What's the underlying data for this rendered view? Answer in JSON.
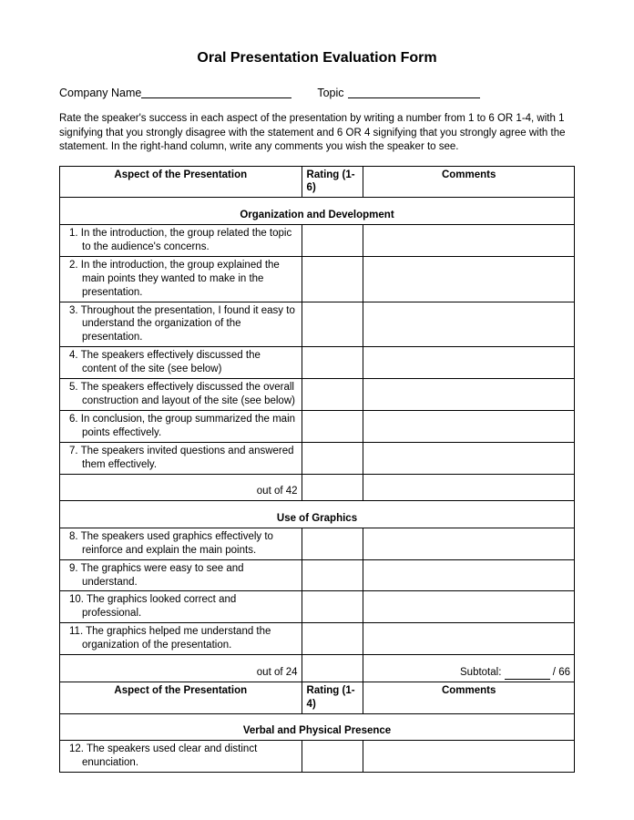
{
  "title": "Oral Presentation Evaluation Form",
  "meta": {
    "company_label": "Company Name",
    "topic_label": "Topic"
  },
  "instructions": "Rate the speaker's success in each aspect of the presentation by writing a number from 1 to 6 OR 1-4, with 1 signifying that you strongly disagree with the statement and 6 OR 4 signifying that you strongly agree with the statement. In the right-hand column, write any comments you wish the speaker to see.",
  "headers": {
    "aspect": "Aspect of the Presentation",
    "rating16": "Rating (1-6)",
    "rating14": "Rating (1-4)",
    "comments": "Comments"
  },
  "sections": {
    "org": {
      "title": "Organization and Development",
      "items": [
        "1. In the introduction, the group related the topic to the audience's concerns.",
        "2. In the introduction, the group explained the main points they wanted to make in the presentation.",
        "3. Throughout the presentation, I found it easy to understand the organization of the presentation.",
        "4. The speakers effectively discussed the content of the site (see below)",
        "5. The speakers effectively discussed the overall construction and layout of the site (see below)",
        "6. In conclusion, the group summarized the main points effectively.",
        "7. The speakers invited questions and answered them effectively."
      ],
      "out_of": "out of 42"
    },
    "graphics": {
      "title": "Use of Graphics",
      "items": [
        "8. The speakers used graphics effectively to reinforce and explain the main points.",
        "9. The graphics were easy to see and understand.",
        "10. The graphics looked correct and professional.",
        "11. The graphics helped me understand the organization of the presentation."
      ],
      "out_of": "out of 24",
      "subtotal_label": "Subtotal:",
      "subtotal_denom": " / 66"
    },
    "verbal": {
      "title": "Verbal and Physical Presence",
      "items": [
        "12. The speakers used clear and distinct enunciation."
      ]
    }
  }
}
